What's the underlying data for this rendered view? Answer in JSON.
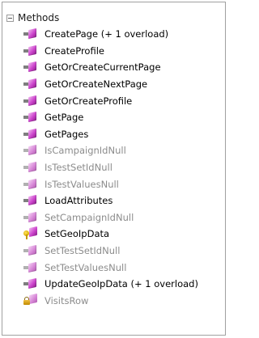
{
  "section": {
    "label": "Methods",
    "expanded": true
  },
  "methods": [
    {
      "label": "CreatePage (+ 1 overload)",
      "icon": "public-method-icon",
      "dim": false
    },
    {
      "label": "CreateProfile",
      "icon": "public-method-icon",
      "dim": false
    },
    {
      "label": "GetOrCreateCurrentPage",
      "icon": "public-method-icon",
      "dim": false
    },
    {
      "label": "GetOrCreateNextPage",
      "icon": "public-method-icon",
      "dim": false
    },
    {
      "label": "GetOrCreateProfile",
      "icon": "public-method-icon",
      "dim": false
    },
    {
      "label": "GetPage",
      "icon": "public-method-icon",
      "dim": false
    },
    {
      "label": "GetPages",
      "icon": "public-method-icon",
      "dim": false
    },
    {
      "label": "IsCampaignIdNull",
      "icon": "public-method-icon",
      "dim": true
    },
    {
      "label": "IsTestSetIdNull",
      "icon": "public-method-icon",
      "dim": true
    },
    {
      "label": "IsTestValuesNull",
      "icon": "public-method-icon",
      "dim": true
    },
    {
      "label": "LoadAttributes",
      "icon": "public-method-icon",
      "dim": false
    },
    {
      "label": "SetCampaignIdNull",
      "icon": "public-method-icon",
      "dim": true
    },
    {
      "label": "SetGeoIpData",
      "icon": "internal-method-icon",
      "dim": false
    },
    {
      "label": "SetTestSetIdNull",
      "icon": "public-method-icon",
      "dim": true
    },
    {
      "label": "SetTestValuesNull",
      "icon": "public-method-icon",
      "dim": true
    },
    {
      "label": "UpdateGeoIpData (+ 1 overload)",
      "icon": "public-method-icon",
      "dim": false
    },
    {
      "label": "VisitsRow",
      "icon": "private-method-icon",
      "dim": true
    }
  ]
}
